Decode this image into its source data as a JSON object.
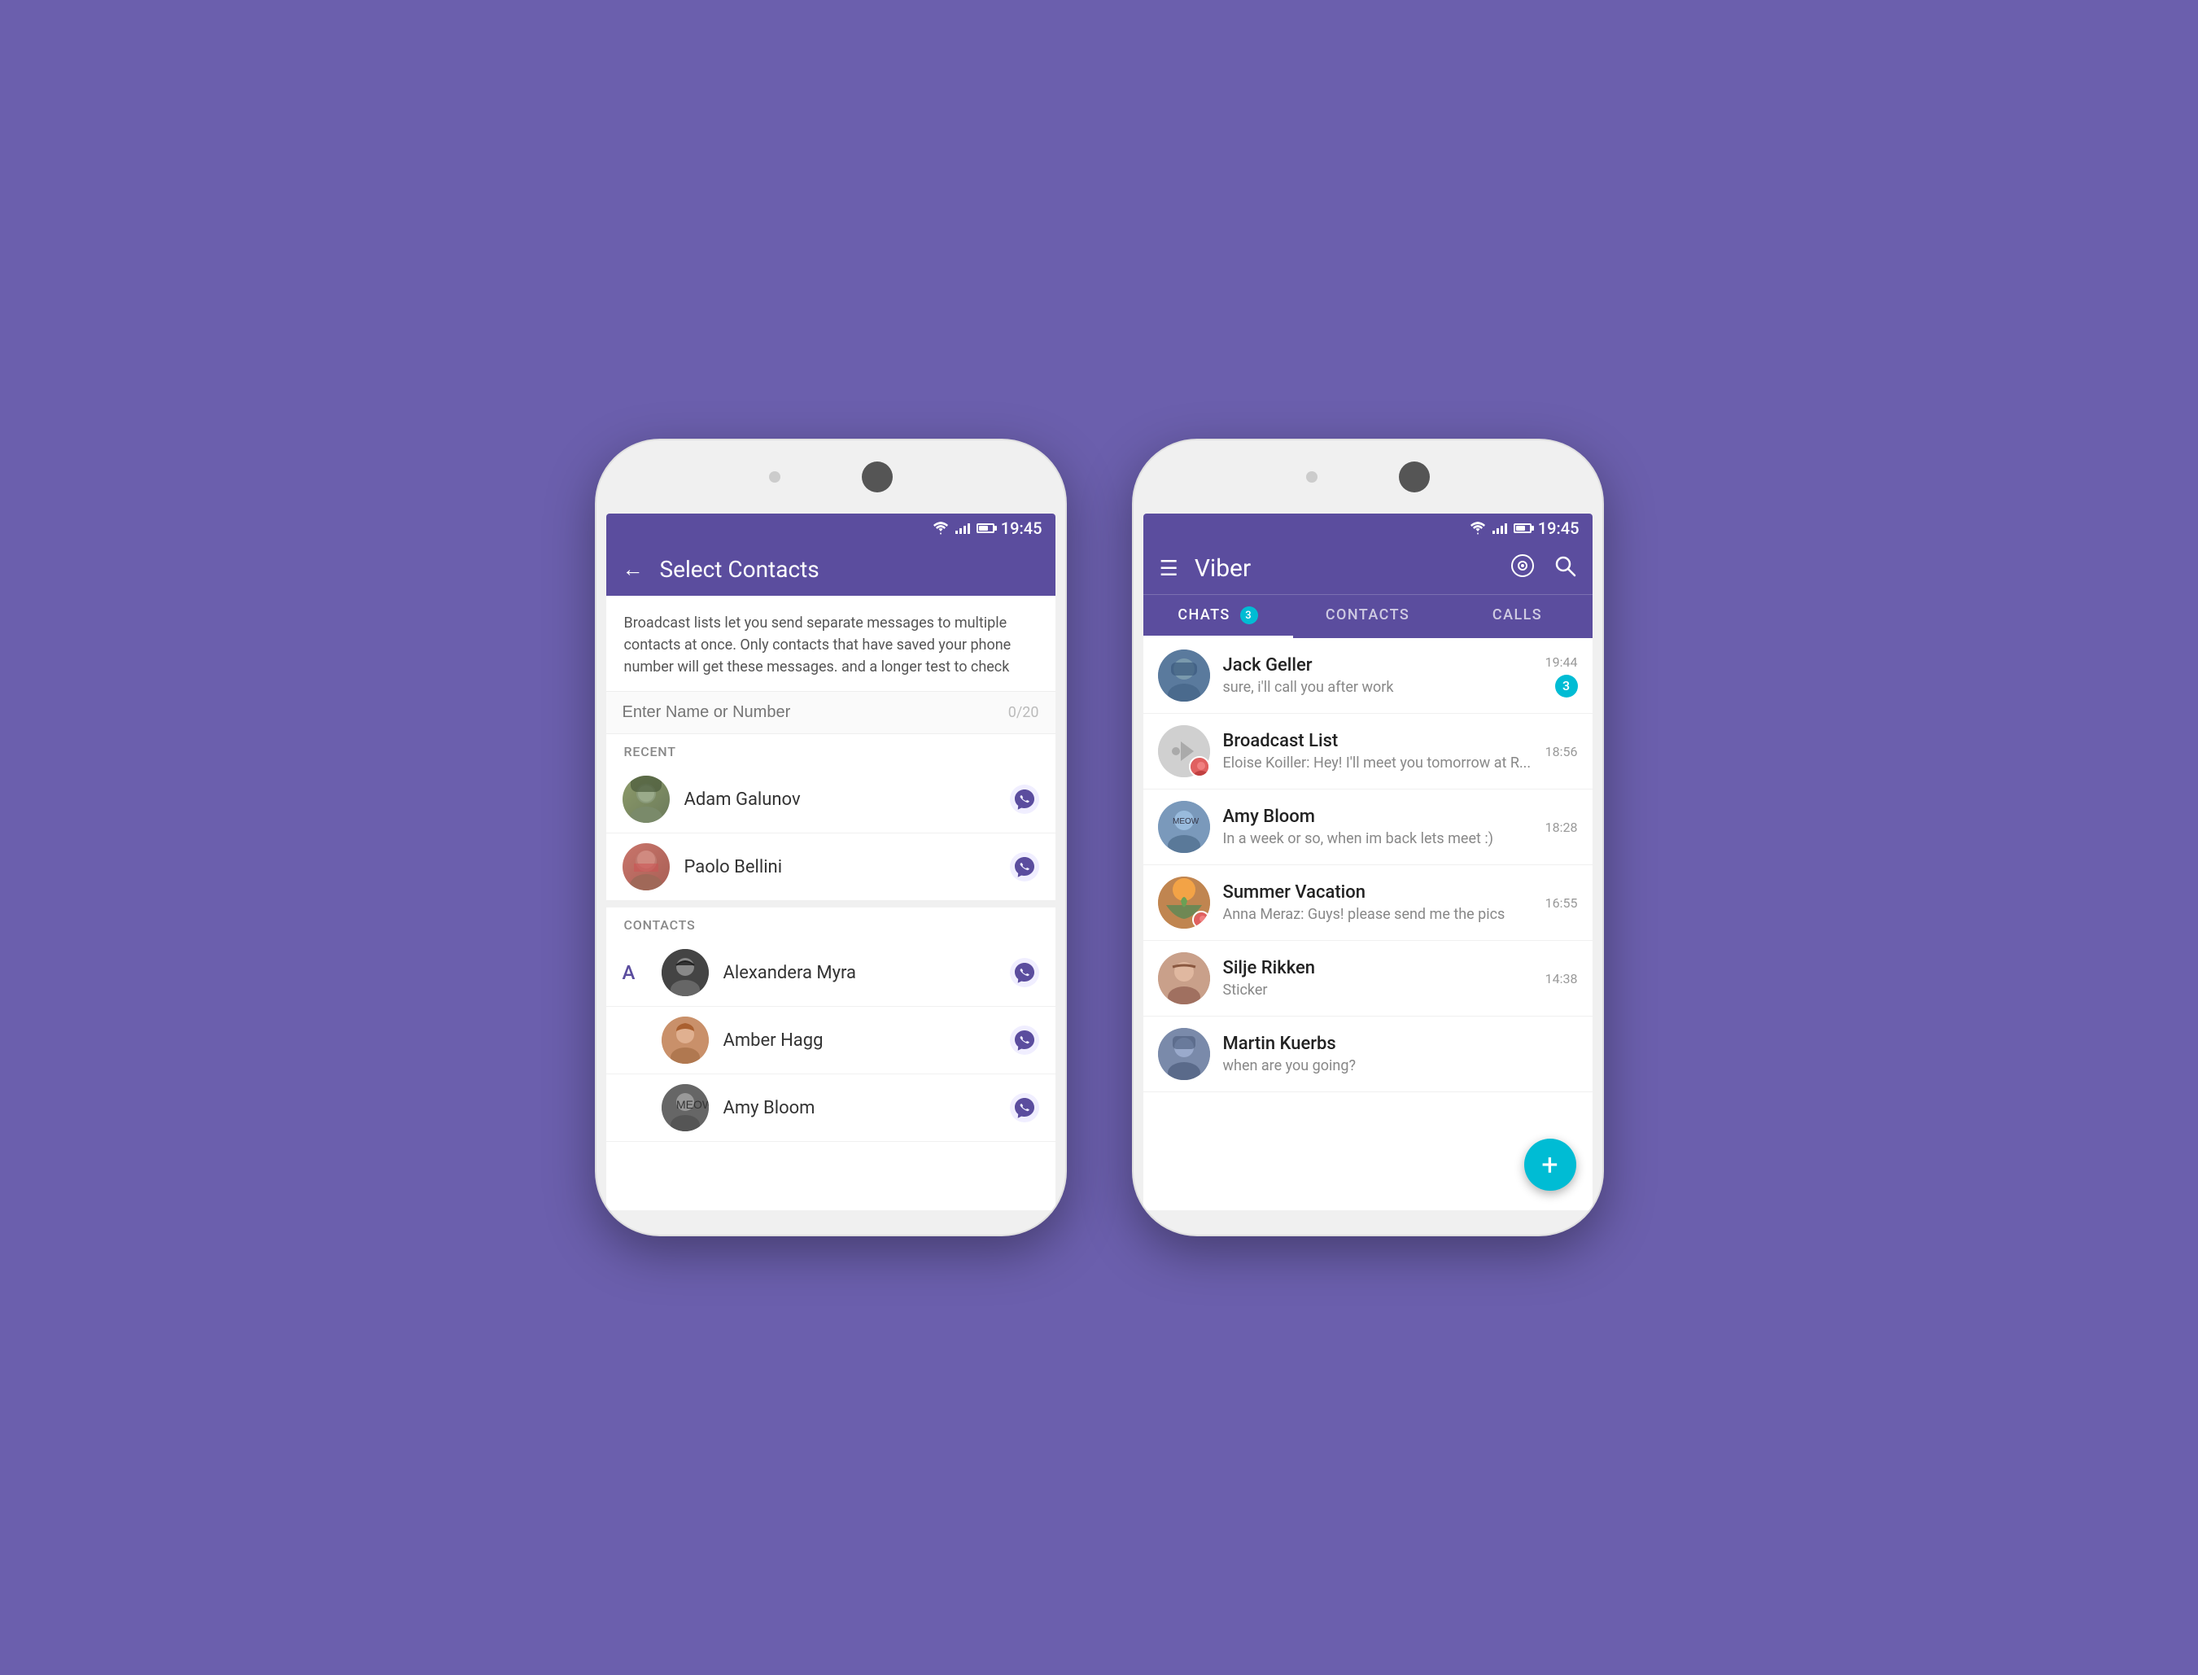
{
  "background": "#6b5fad",
  "phones": {
    "left": {
      "statusBar": {
        "time": "19:45"
      },
      "header": {
        "backLabel": "←",
        "title": "Select Contacts"
      },
      "broadcastText": "Broadcast lists let you send separate messages to multiple contacts at once. Only contacts that have saved your phone number will get these messages. and a longer test to check",
      "searchPlaceholder": "Enter Name or Number",
      "searchCount": "0/20",
      "recentLabel": "RECENT",
      "recentContacts": [
        {
          "name": "Adam Galunov",
          "avatarClass": "av-adam"
        },
        {
          "name": "Paolo Bellini",
          "avatarClass": "av-paolo"
        }
      ],
      "contactsLabel": "CONTACTS",
      "alphaLabel": "A",
      "contacts": [
        {
          "name": "Alexandera Myra",
          "avatarClass": "av-alexandera"
        },
        {
          "name": "Amber Hagg",
          "avatarClass": "av-amber"
        },
        {
          "name": "Amy Bloom",
          "avatarClass": "av-amy-bloom-l"
        }
      ]
    },
    "right": {
      "statusBar": {
        "time": "19:45"
      },
      "header": {
        "title": "Viber"
      },
      "tabs": [
        {
          "label": "CHATS",
          "badge": "3",
          "active": true
        },
        {
          "label": "CONTACTS",
          "badge": null,
          "active": false
        },
        {
          "label": "CALLS",
          "badge": null,
          "active": false
        }
      ],
      "chats": [
        {
          "name": "Jack Geller",
          "preview": "sure, i'll call you after work",
          "time": "19:44",
          "unread": "3",
          "avatarClass": "av-jack"
        },
        {
          "name": "Broadcast List",
          "preview": "Eloise Koiller: Hey! I'll meet you tomorrow at R...",
          "time": "18:56",
          "unread": null,
          "avatarClass": "broadcast",
          "miniAvatarClass": "av-eloise"
        },
        {
          "name": "Amy Bloom",
          "preview": "In a week or so, when im back lets meet :)",
          "time": "18:28",
          "unread": null,
          "avatarClass": "av-amy-bloom-r"
        },
        {
          "name": "Summer Vacation",
          "preview": "Anna Meraz: Guys! please send me the pics",
          "time": "16:55",
          "unread": null,
          "avatarClass": "av-summer",
          "miniAvatarClass": "av-eloise"
        },
        {
          "name": "Silje Rikken",
          "preview": "Sticker",
          "time": "14:38",
          "unread": null,
          "avatarClass": "av-silje"
        },
        {
          "name": "Martin Kuerbs",
          "preview": "when are you going?",
          "time": null,
          "unread": null,
          "avatarClass": "av-martin"
        }
      ],
      "fab": "+"
    }
  }
}
